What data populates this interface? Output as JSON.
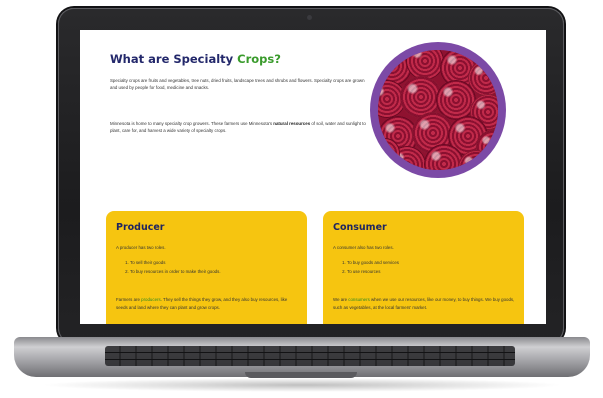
{
  "page": {
    "title_part1": "What are Specialty ",
    "title_part2": "Crops?",
    "para1": "Specialty crops are fruits and vegetables, tree nuts, dried fruits, landscape trees and shrubs and flowers. Specialty crops are grown and used by people for food, medicine and snacks.",
    "para2_a": "Minnesota is home to many specialty crop growers. These farmers use Minnesota's ",
    "para2_b": "natural resources",
    "para2_c": " of soil, water and sunlight to plant, care for, and harvest a wide variety of specialty crops."
  },
  "producer": {
    "heading": "Producer",
    "intro": "A producer has two roles.",
    "roles": [
      "To sell their goods",
      "To buy resources in order to make their goods."
    ],
    "desc_a": "Farmers are ",
    "desc_b": "producers",
    "desc_c": ". They sell the things they grow, and they also buy resources, like seeds and land where they can plant and grow crops."
  },
  "consumer": {
    "heading": "Consumer",
    "intro": "A consumer also has two roles.",
    "roles": [
      "To buy goods and services",
      "To use resources"
    ],
    "desc_a": "We are ",
    "desc_b": "consumers",
    "desc_c": " when we use our resources, like our money, to buy things. We buy goods, such as vegetables, at the local farmers' market."
  },
  "colors": {
    "title_navy": "#23286b",
    "title_green": "#3a9b2c",
    "card_yellow": "#f6c510",
    "circle_purple": "#7c4aa6",
    "laptop_bezel": "#1c1c1e"
  },
  "image": {
    "description_icon": "raspberries-photo"
  }
}
